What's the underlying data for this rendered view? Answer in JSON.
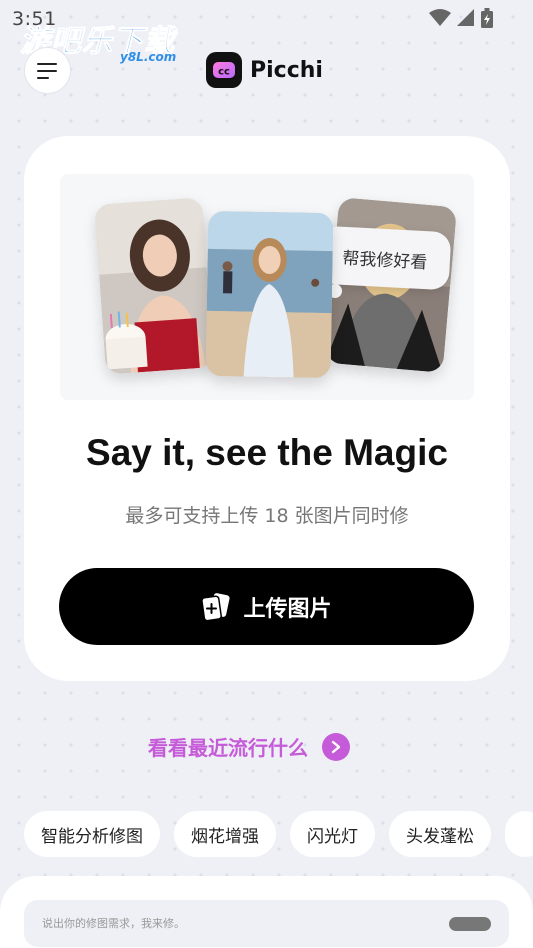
{
  "status": {
    "time": "3:51"
  },
  "watermark": {
    "text": "游吧乐下载",
    "sub": "y8L.com"
  },
  "header": {
    "app_name": "Picchi"
  },
  "card": {
    "bubble_text": "帮我修好看",
    "headline": "Say it, see the Magic",
    "subline": "最多可支持上传 18 张图片同时修",
    "upload_label": "上传图片"
  },
  "trending": {
    "label": "看看最近流行什么"
  },
  "chips": [
    "智能分析修图",
    "烟花增强",
    "闪光灯",
    "头发蓬松",
    ""
  ],
  "prompt": {
    "placeholder": "说出你的修图需求，我来修。"
  },
  "colors": {
    "accent": "#c65bd9",
    "background": "#eef0f5",
    "primary_button": "#000000"
  }
}
